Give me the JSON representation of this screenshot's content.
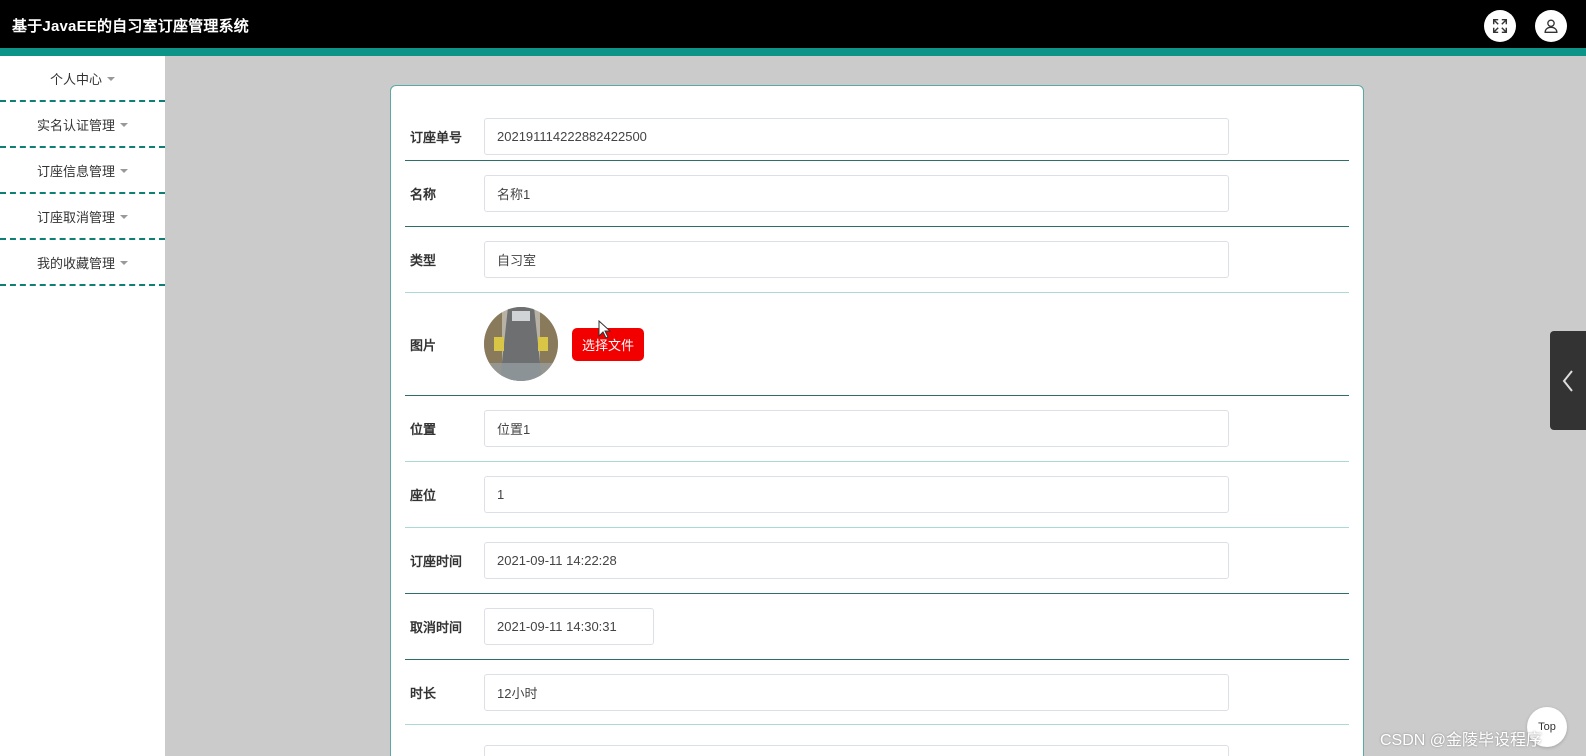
{
  "header": {
    "title": "基于JavaEE的自习室订座管理系统",
    "fullscreen_icon": "expand-icon",
    "user_icon": "user-icon"
  },
  "sidebar": {
    "items": [
      {
        "label": "个人中心"
      },
      {
        "label": "实名认证管理"
      },
      {
        "label": "订座信息管理"
      },
      {
        "label": "订座取消管理"
      },
      {
        "label": "我的收藏管理"
      }
    ]
  },
  "form": {
    "order_no": {
      "label": "订座单号",
      "value": "202191114222882422500"
    },
    "name": {
      "label": "名称",
      "value": "名称1"
    },
    "type": {
      "label": "类型",
      "value": "自习室"
    },
    "image": {
      "label": "图片",
      "button": "选择文件"
    },
    "location": {
      "label": "位置",
      "value": "位置1"
    },
    "seat": {
      "label": "座位",
      "value": "1"
    },
    "booking_time": {
      "label": "订座时间",
      "value": "2021-09-11 14:22:28"
    },
    "cancel_time": {
      "label": "取消时间",
      "value": "2021-09-11 14:30:31"
    },
    "duration": {
      "label": "时长",
      "value": "12小时"
    }
  },
  "widgets": {
    "top_button": "Top",
    "watermark": "CSDN @金陵毕设程序"
  },
  "colors": {
    "accent": "#0d9488",
    "danger": "#f20000"
  }
}
